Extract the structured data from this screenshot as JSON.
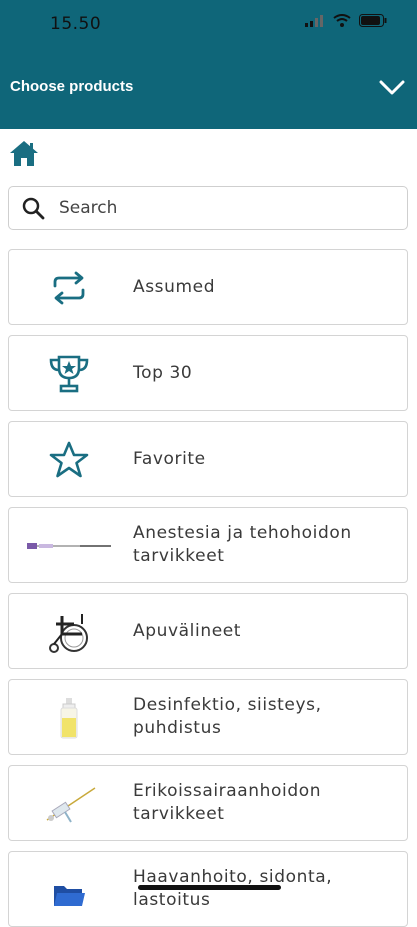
{
  "status": {
    "time": "15.50"
  },
  "header": {
    "title": "Choose products"
  },
  "search": {
    "placeholder": "Search"
  },
  "items": [
    {
      "label": "Assumed",
      "icon": "repeat-icon"
    },
    {
      "label": "Top 30",
      "icon": "trophy-icon"
    },
    {
      "label": "Favorite",
      "icon": "star-icon"
    },
    {
      "label": "Anestesia ja tehohoidon tarvikkeet",
      "icon": "anesthesia-thumbnail"
    },
    {
      "label": "Apuvälineet",
      "icon": "wheelchair-thumbnail"
    },
    {
      "label": "Desinfektio, siisteys, puhdistus",
      "icon": "disinfectant-bottle-thumbnail"
    },
    {
      "label": "Erikoissairaanhoidon tarvikkeet",
      "icon": "catheter-thumbnail"
    },
    {
      "label": "Haavanhoito, sidonta, lastoitus",
      "icon": "folder-thumbnail"
    }
  ],
  "colors": {
    "header": "#0f6679",
    "accent": "#1a6e82"
  }
}
